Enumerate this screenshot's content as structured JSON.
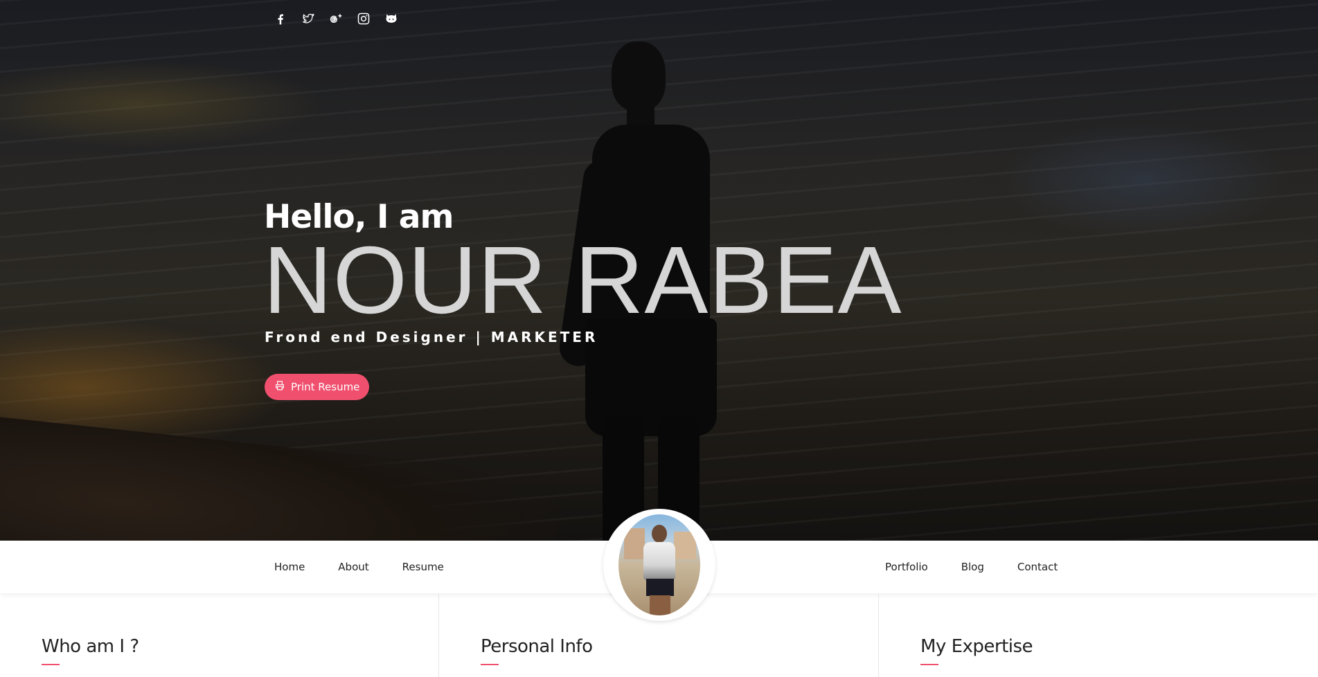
{
  "social": {
    "icons": [
      "facebook-icon",
      "twitter-icon",
      "google-plus-icon",
      "instagram-icon",
      "github-icon"
    ]
  },
  "hero": {
    "greeting": "Hello, I am",
    "name": "NOUR RABEA",
    "role": "Frond end Designer | MARKETER",
    "print_button_label": "Print Resume"
  },
  "nav": {
    "left": [
      "Home",
      "About",
      "Resume"
    ],
    "right": [
      "Portfolio",
      "Blog",
      "Contact"
    ]
  },
  "sections": {
    "who": "Who am I ?",
    "personal": "Personal Info",
    "expertise": "My Expertise"
  },
  "colors": {
    "accent": "#f0506e"
  }
}
